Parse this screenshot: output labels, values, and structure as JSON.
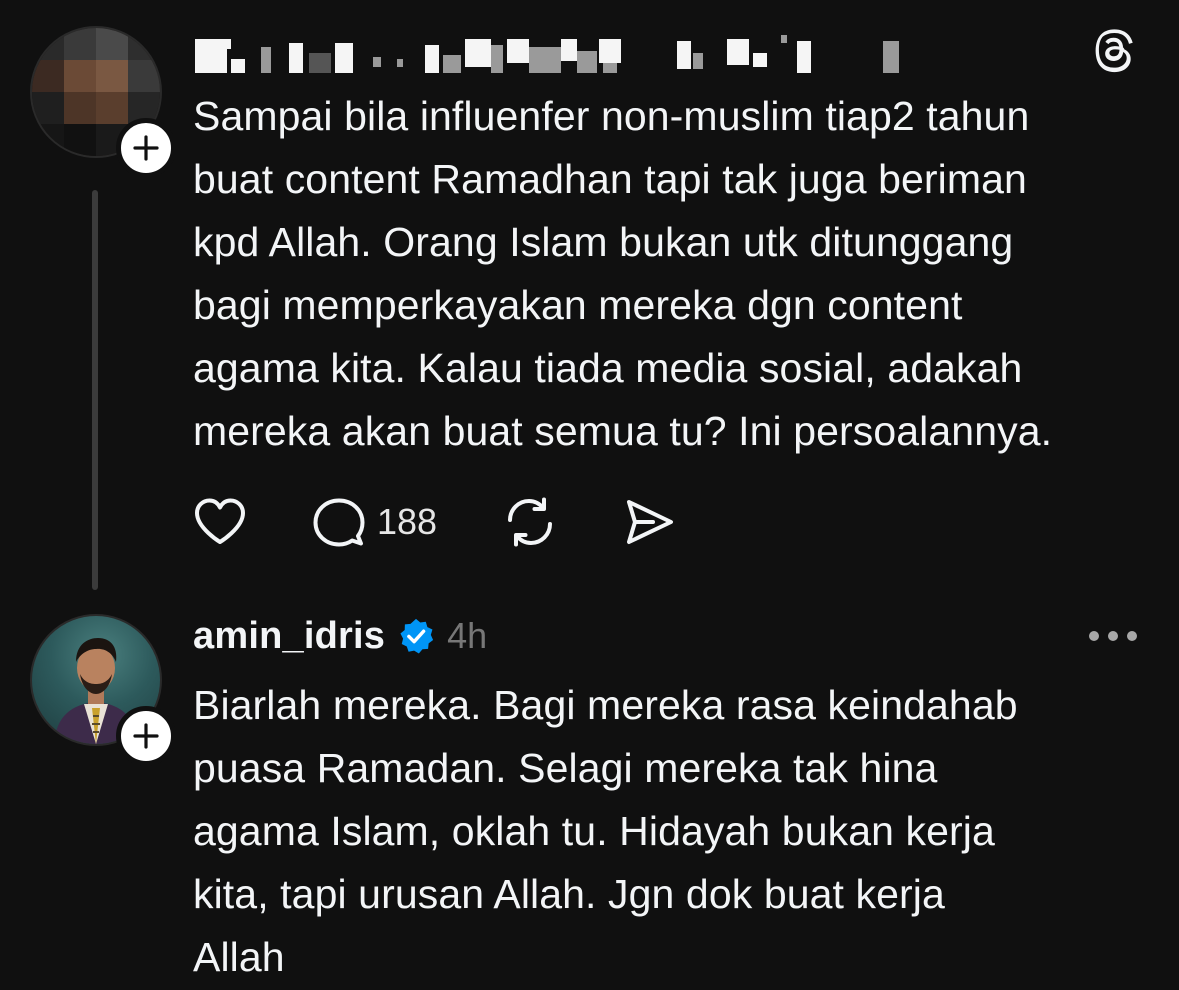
{
  "colors": {
    "background": "#101010",
    "text_primary": "#f3f5f7",
    "text_secondary": "#777777",
    "verified_blue": "#0095f6",
    "thread_line": "#3b3b3b"
  },
  "posts": [
    {
      "username": "",
      "username_censored": true,
      "avatar_censored": true,
      "text": "Sampai bila influenfer non-muslim tiap2 tahun\nbuat content Ramadhan tapi tak juga beriman\nkpd Allah. Orang Islam bukan utk ditunggang\nbagi memperkayakan mereka dgn content\nagama kita. Kalau tiada media sosial, adakah\nmereka akan buat semua tu? Ini persoalannya.",
      "actions": {
        "like_icon": "heart-icon",
        "reply_icon": "comment-icon",
        "reply_count": "188",
        "repost_icon": "repost-icon",
        "share_icon": "send-icon"
      },
      "header_icon": "threads-logo-icon"
    },
    {
      "username": "amin_idris",
      "verified": true,
      "time": "4h",
      "text": "Biarlah mereka. Bagi mereka rasa keindahab\npuasa Ramadan. Selagi mereka tak hina\nagama Islam, oklah tu. Hidayah bukan kerja\nkita, tapi urusan Allah. Jgn dok buat kerja\nAllah",
      "header_icon": "more-options-icon"
    }
  ]
}
